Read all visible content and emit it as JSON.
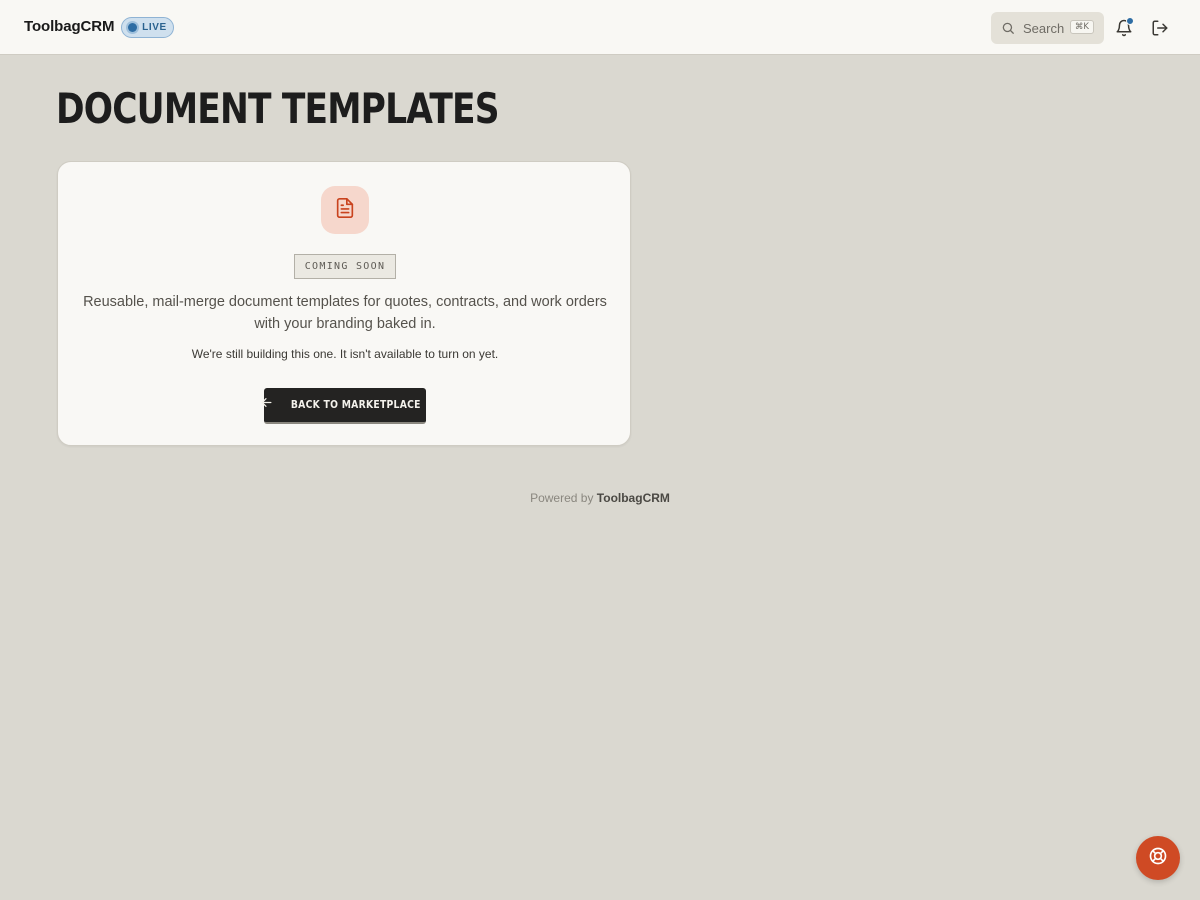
{
  "app": {
    "brand": "ToolbagCRM",
    "status_badge": "LIVE"
  },
  "header": {
    "search_label": "Search",
    "search_shortcut": "⌘K",
    "icons": [
      "search-icon",
      "bell-icon",
      "logout-icon"
    ]
  },
  "page": {
    "title": "DOCUMENT TEMPLATES"
  },
  "card": {
    "icon": "document-icon",
    "badge": "COMING SOON",
    "description": "Reusable, mail-merge document templates for quotes, contracts, and work orders with your branding baked in.",
    "note": "We're still building this one. It isn't available to turn on yet.",
    "back_button": "BACK TO MARKETPLACE"
  },
  "footer": {
    "prefix": "Powered by",
    "brand": "ToolbagCRM"
  },
  "help": {
    "icon": "lifebuoy-icon"
  },
  "colors": {
    "background": "#dad8d0",
    "accent": "#cf4a24",
    "live_blue": "#2e6da4",
    "card": "#f9f8f5",
    "button_dark": "#242322"
  }
}
